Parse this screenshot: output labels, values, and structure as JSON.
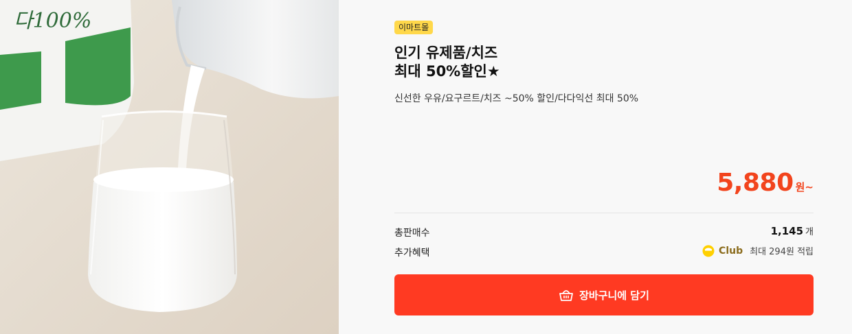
{
  "product": {
    "store_badge": "이마트몰",
    "title_line1": "인기 유제품/치즈",
    "title_line2": "최대 50%할인★",
    "subtitle": "신선한 우유/요구르트/치즈 ~50% 할인/다다익선 최대 50%",
    "image_icon": "milk-glass-photo"
  },
  "price": {
    "amount": "5,880",
    "unit": "원~",
    "color": "#f2441d"
  },
  "details": {
    "sales_label": "총판매수",
    "sales_value": "1,145",
    "sales_unit": "개",
    "benefit_label": "추가혜택",
    "club_name": "Club",
    "club_benefit": "최대 294원 적립",
    "club_icon": "club-coin-icon"
  },
  "actions": {
    "cart_label": "장바구니에 담기",
    "cart_icon": "basket-icon",
    "button_color": "#ff3a22"
  },
  "colors": {
    "badge": "#ffd84a",
    "club_accent": "#8b6c1d"
  }
}
